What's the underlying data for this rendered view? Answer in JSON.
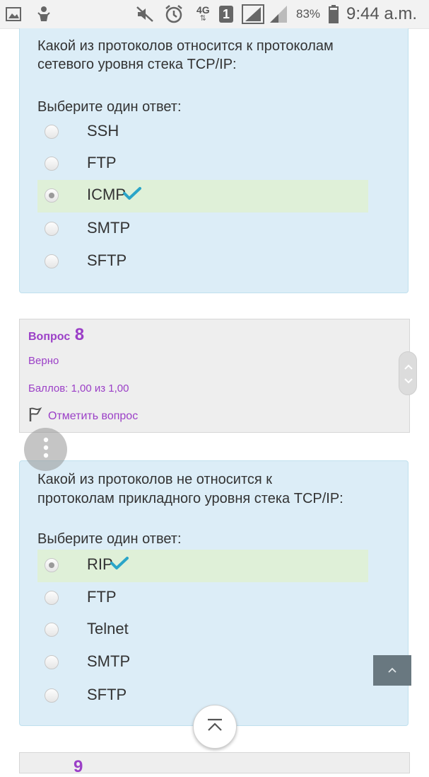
{
  "status_bar": {
    "sim_badge": "1",
    "network": "4G",
    "battery": "83%",
    "time": "9:44 a.m.",
    "icons": [
      "image-icon",
      "robot-icon",
      "mute-icon",
      "alarm-icon",
      "network-4g-icon",
      "sim-badge-icon",
      "signal-icon",
      "signal-icon",
      "battery-icon"
    ]
  },
  "question7": {
    "prompt_line1": "Какой из протоколов относится к протоколам",
    "prompt_line2": "сетевого уровня стека TCP/IP:",
    "choose_label": "Выберите один ответ:",
    "options": [
      {
        "label": "SSH",
        "checked": false,
        "correct": false
      },
      {
        "label": "FTP",
        "checked": false,
        "correct": false
      },
      {
        "label": "ICMP",
        "checked": true,
        "correct": true
      },
      {
        "label": "SMTP",
        "checked": false,
        "correct": false
      },
      {
        "label": "SFTP",
        "checked": false,
        "correct": false
      }
    ]
  },
  "question8_info": {
    "label": "Вопрос",
    "number": "8",
    "state": "Верно",
    "grade": "Баллов: 1,00 из 1,00",
    "flag_label": "Отметить вопрос"
  },
  "question8": {
    "prompt_line1": "Какой из протоколов не относится к",
    "prompt_line2": "протоколам прикладного уровня стека TCP/IP:",
    "choose_label": "Выберите один ответ:",
    "options": [
      {
        "label": "RIP",
        "checked": true,
        "correct": true
      },
      {
        "label": "FTP",
        "checked": false,
        "correct": false
      },
      {
        "label": "Telnet",
        "checked": false,
        "correct": false
      },
      {
        "label": "SMTP",
        "checked": false,
        "correct": false
      },
      {
        "label": "SFTP",
        "checked": false,
        "correct": false
      }
    ]
  },
  "next_info": {
    "number": "9"
  },
  "colors": {
    "question_bg": "#dcedf7",
    "correct_bg": "#dff0d8",
    "accent": "#9b3fc7",
    "check": "#2aa5c8"
  }
}
